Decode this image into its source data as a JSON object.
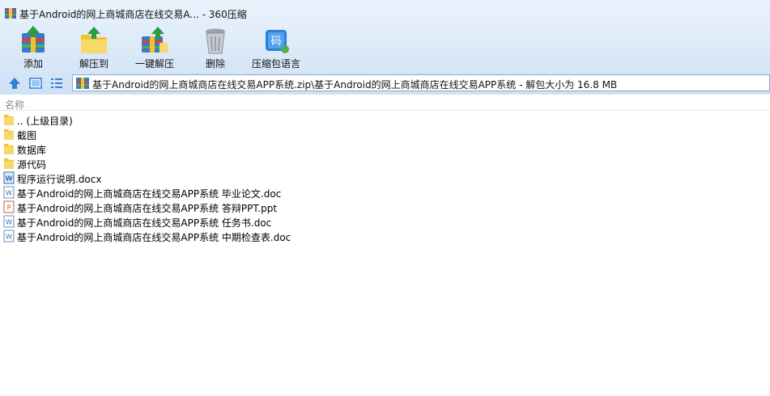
{
  "window": {
    "title": "基于Android的网上商城商店在线交易A... - 360压缩"
  },
  "toolbar": {
    "add_label": "添加",
    "extract_to_label": "解压到",
    "one_click_label": "一键解压",
    "delete_label": "删除",
    "language_label": "压缩包语言"
  },
  "address": {
    "path": "基于Android的网上商城商店在线交易APP系统.zip\\基于Android的网上商城商店在线交易APP系统 - 解包大小为 16.8 MB"
  },
  "list": {
    "column_name": "名称",
    "items": [
      {
        "name": ".. (上级目录)",
        "type": "folder"
      },
      {
        "name": "截图",
        "type": "folder"
      },
      {
        "name": "数据库",
        "type": "folder"
      },
      {
        "name": "源代码",
        "type": "folder"
      },
      {
        "name": "程序运行说明.docx",
        "type": "docx"
      },
      {
        "name": "基于Android的网上商城商店在线交易APP系统 毕业论文.doc",
        "type": "doc"
      },
      {
        "name": "基于Android的网上商城商店在线交易APP系统 答辩PPT.ppt",
        "type": "ppt"
      },
      {
        "name": "基于Android的网上商城商店在线交易APP系统 任务书.doc",
        "type": "doc"
      },
      {
        "name": "基于Android的网上商城商店在线交易APP系统 中期检查表.doc",
        "type": "doc"
      }
    ]
  },
  "colors": {
    "chrome_top": "#eaf3fc",
    "chrome_bottom": "#cfe1f5",
    "folder": "#f7d36b",
    "accent_blue": "#2f7fd6"
  }
}
